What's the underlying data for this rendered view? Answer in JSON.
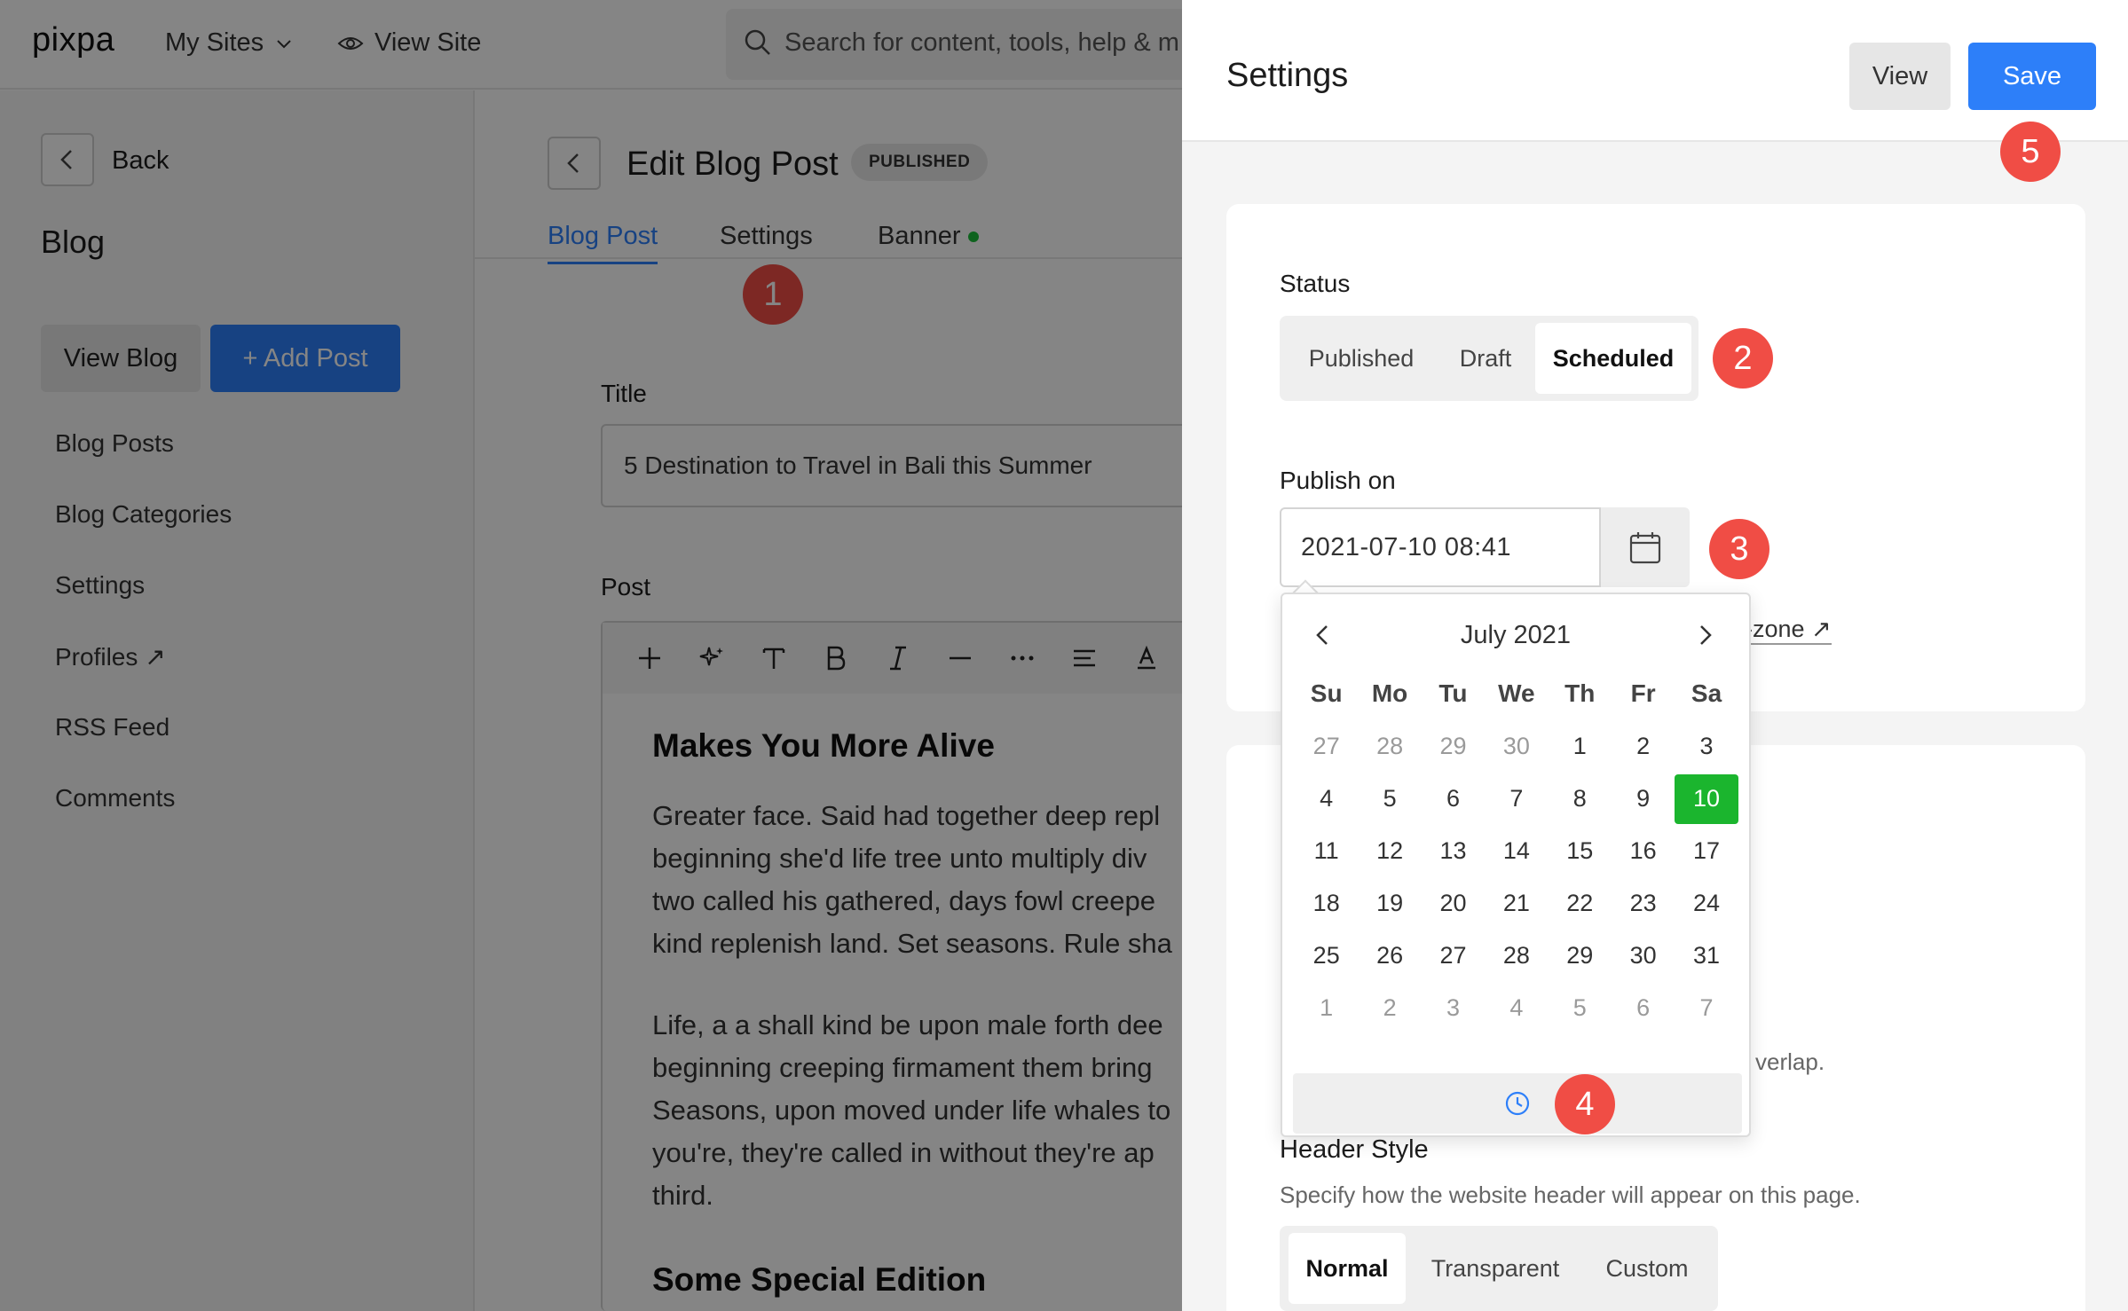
{
  "topbar": {
    "logo": "pixpa",
    "my_sites": "My Sites",
    "view_site": "View Site",
    "search_placeholder": "Search for content, tools, help & m"
  },
  "sidebar": {
    "back": "Back",
    "heading": "Blog",
    "view_blog": "View Blog",
    "add_post": "+ Add Post",
    "items": [
      {
        "label": "Blog Posts"
      },
      {
        "label": "Blog Categories"
      },
      {
        "label": "Settings"
      },
      {
        "label": "Profiles ↗"
      },
      {
        "label": "RSS Feed"
      },
      {
        "label": "Comments"
      }
    ]
  },
  "editor": {
    "title": "Edit Blog Post",
    "badge": "PUBLISHED",
    "tabs": [
      {
        "label": "Blog Post"
      },
      {
        "label": "Settings"
      },
      {
        "label": "Banner"
      }
    ],
    "title_label": "Title",
    "title_value": "5 Destination to Travel in Bali this Summer",
    "post_label": "Post",
    "content": {
      "heading1": "Makes You More Alive",
      "para1": [
        "Greater face. Said had together deep repl",
        "beginning she'd life tree unto multiply div",
        "two called his gathered, days fowl creepe",
        "kind replenish land. Set seasons. Rule sha"
      ],
      "para2": [
        "Life, a a shall kind be upon male forth dee",
        "beginning creeping firmament them bring",
        "Seasons, upon moved under life whales to",
        "you're, they're called in without they're ap",
        "third."
      ],
      "heading2": "Some Special Edition"
    }
  },
  "panel": {
    "title": "Settings",
    "view_button": "View",
    "save_button": "Save",
    "status_label": "Status",
    "status_options": [
      "Published",
      "Draft",
      "Scheduled"
    ],
    "status_selected": "Scheduled",
    "publish_label": "Publish on",
    "publish_value": "2021-07-10 08:41",
    "timezone_link": "-zone ↗",
    "overlap_text": "verlap.",
    "header_style_label": "Header Style",
    "header_style_desc": "Specify how the website header will appear on this page.",
    "header_style_options": [
      "Normal",
      "Transparent",
      "Custom"
    ],
    "header_style_selected": "Normal"
  },
  "datepicker": {
    "month": "July 2021",
    "weekdays": [
      "Su",
      "Mo",
      "Tu",
      "We",
      "Th",
      "Fr",
      "Sa"
    ],
    "weeks": [
      [
        {
          "d": "27",
          "m": true
        },
        {
          "d": "28",
          "m": true
        },
        {
          "d": "29",
          "m": true
        },
        {
          "d": "30",
          "m": true
        },
        {
          "d": "1"
        },
        {
          "d": "2"
        },
        {
          "d": "3"
        }
      ],
      [
        {
          "d": "4"
        },
        {
          "d": "5"
        },
        {
          "d": "6"
        },
        {
          "d": "7"
        },
        {
          "d": "8"
        },
        {
          "d": "9"
        },
        {
          "d": "10",
          "s": true
        }
      ],
      [
        {
          "d": "11"
        },
        {
          "d": "12"
        },
        {
          "d": "13"
        },
        {
          "d": "14"
        },
        {
          "d": "15"
        },
        {
          "d": "16"
        },
        {
          "d": "17"
        }
      ],
      [
        {
          "d": "18"
        },
        {
          "d": "19"
        },
        {
          "d": "20"
        },
        {
          "d": "21"
        },
        {
          "d": "22"
        },
        {
          "d": "23"
        },
        {
          "d": "24"
        }
      ],
      [
        {
          "d": "25"
        },
        {
          "d": "26"
        },
        {
          "d": "27"
        },
        {
          "d": "28"
        },
        {
          "d": "29"
        },
        {
          "d": "30"
        },
        {
          "d": "31"
        }
      ],
      [
        {
          "d": "1",
          "m": true
        },
        {
          "d": "2",
          "m": true
        },
        {
          "d": "3",
          "m": true
        },
        {
          "d": "4",
          "m": true
        },
        {
          "d": "5",
          "m": true
        },
        {
          "d": "6",
          "m": true
        },
        {
          "d": "7",
          "m": true
        }
      ]
    ],
    "selected_color": "#1bb52e"
  },
  "steps": [
    "1",
    "2",
    "3",
    "4",
    "5"
  ],
  "colors": {
    "accent": "#2d7ff9",
    "step_marker": "#f04d45",
    "selected_day": "#1bb52e",
    "banner_dot": "#1bbf3a"
  },
  "icons": {
    "search": "search-icon",
    "eye": "eye-icon",
    "chevron_down": "chevron-down-icon",
    "calendar": "calendar-icon",
    "clock": "clock-icon"
  }
}
